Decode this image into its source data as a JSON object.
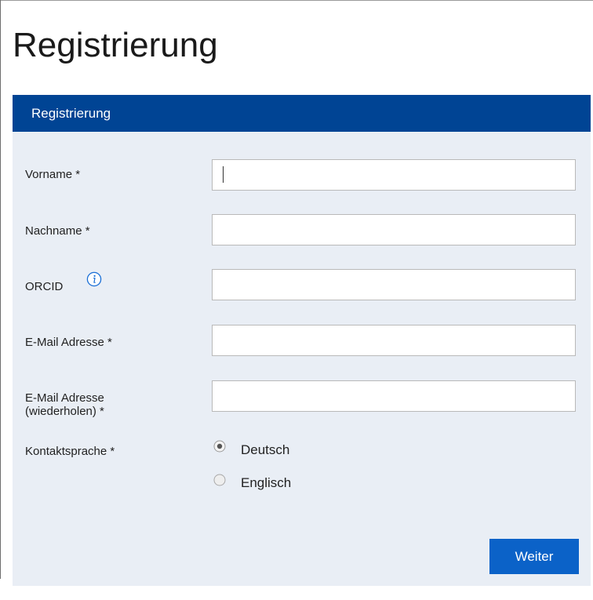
{
  "page": {
    "title": "Registrierung"
  },
  "panel": {
    "header_label": "Registrierung",
    "header_color": "#004494",
    "body_color": "#e9eef5"
  },
  "form": {
    "fields": [
      {
        "label": "Vorname *",
        "value": ""
      },
      {
        "label": "Nachname *",
        "value": ""
      },
      {
        "label": "ORCID",
        "value": "",
        "icon": "info-icon"
      },
      {
        "label": "E-Mail Adresse *",
        "value": ""
      },
      {
        "label_line1": "E-Mail Adresse",
        "label_line2": "(wiederholen) *",
        "value": ""
      }
    ],
    "contact_language": {
      "label": "Kontaktsprache *",
      "options": [
        "Deutsch",
        "Englisch"
      ],
      "selected": "Deutsch"
    },
    "submit_label": "Weiter",
    "button_color": "#0b62c8"
  }
}
